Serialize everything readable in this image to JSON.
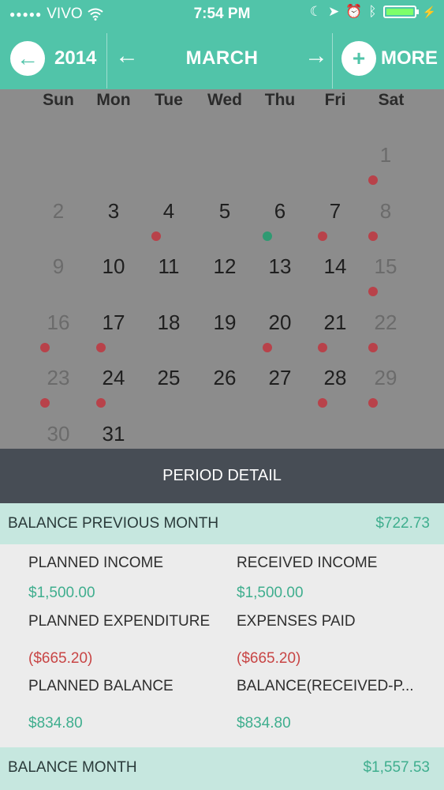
{
  "status_bar": {
    "carrier": "VIVO",
    "time": "7:54 PM"
  },
  "nav": {
    "year": "2014",
    "month": "MARCH",
    "more_label": "MORE"
  },
  "calendar": {
    "weekdays": [
      "Sun",
      "Mon",
      "Tue",
      "Wed",
      "Thu",
      "Fri",
      "Sat"
    ],
    "days": [
      {
        "d": "1",
        "w": 6,
        "r": 0,
        "dot": "red"
      },
      {
        "d": "2",
        "w": 0,
        "r": 1
      },
      {
        "d": "3",
        "w": 1,
        "r": 1
      },
      {
        "d": "4",
        "w": 2,
        "r": 1,
        "dot": "red"
      },
      {
        "d": "5",
        "w": 3,
        "r": 1
      },
      {
        "d": "6",
        "w": 4,
        "r": 1,
        "dot": "green"
      },
      {
        "d": "7",
        "w": 5,
        "r": 1,
        "dot": "red"
      },
      {
        "d": "8",
        "w": 6,
        "r": 1,
        "dot": "red"
      },
      {
        "d": "9",
        "w": 0,
        "r": 2
      },
      {
        "d": "10",
        "w": 1,
        "r": 2
      },
      {
        "d": "11",
        "w": 2,
        "r": 2
      },
      {
        "d": "12",
        "w": 3,
        "r": 2
      },
      {
        "d": "13",
        "w": 4,
        "r": 2
      },
      {
        "d": "14",
        "w": 5,
        "r": 2
      },
      {
        "d": "15",
        "w": 6,
        "r": 2,
        "dot": "red"
      },
      {
        "d": "16",
        "w": 0,
        "r": 3,
        "dot": "red"
      },
      {
        "d": "17",
        "w": 1,
        "r": 3,
        "dot": "red"
      },
      {
        "d": "18",
        "w": 2,
        "r": 3
      },
      {
        "d": "19",
        "w": 3,
        "r": 3
      },
      {
        "d": "20",
        "w": 4,
        "r": 3,
        "dot": "red"
      },
      {
        "d": "21",
        "w": 5,
        "r": 3,
        "dot": "red"
      },
      {
        "d": "22",
        "w": 6,
        "r": 3,
        "dot": "red"
      },
      {
        "d": "23",
        "w": 0,
        "r": 4,
        "dot": "red"
      },
      {
        "d": "24",
        "w": 1,
        "r": 4,
        "dot": "red"
      },
      {
        "d": "25",
        "w": 2,
        "r": 4
      },
      {
        "d": "26",
        "w": 3,
        "r": 4
      },
      {
        "d": "27",
        "w": 4,
        "r": 4
      },
      {
        "d": "28",
        "w": 5,
        "r": 4,
        "dot": "red"
      },
      {
        "d": "29",
        "w": 6,
        "r": 4,
        "dot": "red"
      },
      {
        "d": "30",
        "w": 0,
        "r": 5
      },
      {
        "d": "31",
        "w": 1,
        "r": 5
      }
    ]
  },
  "detail": {
    "title": "PERIOD DETAIL",
    "balance_previous_label": "BALANCE PREVIOUS MONTH",
    "balance_previous_value": "$722.73",
    "planned_income_label": "PLANNED INCOME",
    "planned_income_value": "$1,500.00",
    "received_income_label": "RECEIVED INCOME",
    "received_income_value": "$1,500.00",
    "planned_expenditure_label": "PLANNED EXPENDITURE",
    "planned_expenditure_value": "($665.20)",
    "expenses_paid_label": "EXPENSES PAID",
    "expenses_paid_value": "($665.20)",
    "planned_balance_label": "PLANNED BALANCE",
    "planned_balance_value": "$834.80",
    "balance_received_label": "BALANCE(RECEIVED-P...",
    "balance_received_value": "$834.80",
    "balance_month_label": "BALANCE MONTH",
    "balance_month_value": "$1,557.53"
  },
  "colors": {
    "accent": "#51c4a9",
    "detail_header": "#474d55",
    "positive": "#3fae8e",
    "negative": "#c84545"
  }
}
